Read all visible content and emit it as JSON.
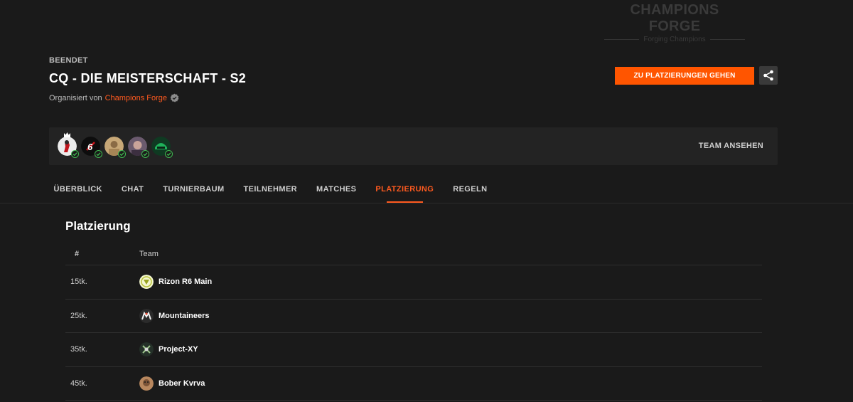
{
  "brand": {
    "title": "CHAMPIONS FORGE",
    "subtitle": "Forging Champions"
  },
  "tournament": {
    "status": "BEENDET",
    "title": "CQ - DIE MEISTERSCHAFT - S2",
    "organized_by_label": "Organisiert von",
    "organizer": "Champions Forge"
  },
  "actions": {
    "cta_label": "ZU PLATZIERUNGEN GEHEN",
    "share_icon": "share-icon"
  },
  "team": {
    "view_label": "TEAM ANSEHEN",
    "member_count": 5
  },
  "tabs": [
    {
      "label": "ÜBERBLICK",
      "active": false
    },
    {
      "label": "CHAT",
      "active": false
    },
    {
      "label": "TURNIERBAUM",
      "active": false
    },
    {
      "label": "TEILNEHMER",
      "active": false
    },
    {
      "label": "MATCHES",
      "active": false
    },
    {
      "label": "PLATZIERUNG",
      "active": true
    },
    {
      "label": "REGELN",
      "active": false
    }
  ],
  "standings": {
    "title": "Platzierung",
    "headers": {
      "rank": "#",
      "team": "Team"
    },
    "rows": [
      {
        "rank": "15tk.",
        "team": "Rizon R6 Main"
      },
      {
        "rank": "25tk.",
        "team": "Mountaineers"
      },
      {
        "rank": "35tk.",
        "team": "Project-XY"
      },
      {
        "rank": "45tk.",
        "team": "Bober Kvrva"
      }
    ]
  },
  "colors": {
    "accent": "#ff5500",
    "background": "#1a1a1a",
    "panel": "#232323",
    "check": "#3fb950"
  }
}
